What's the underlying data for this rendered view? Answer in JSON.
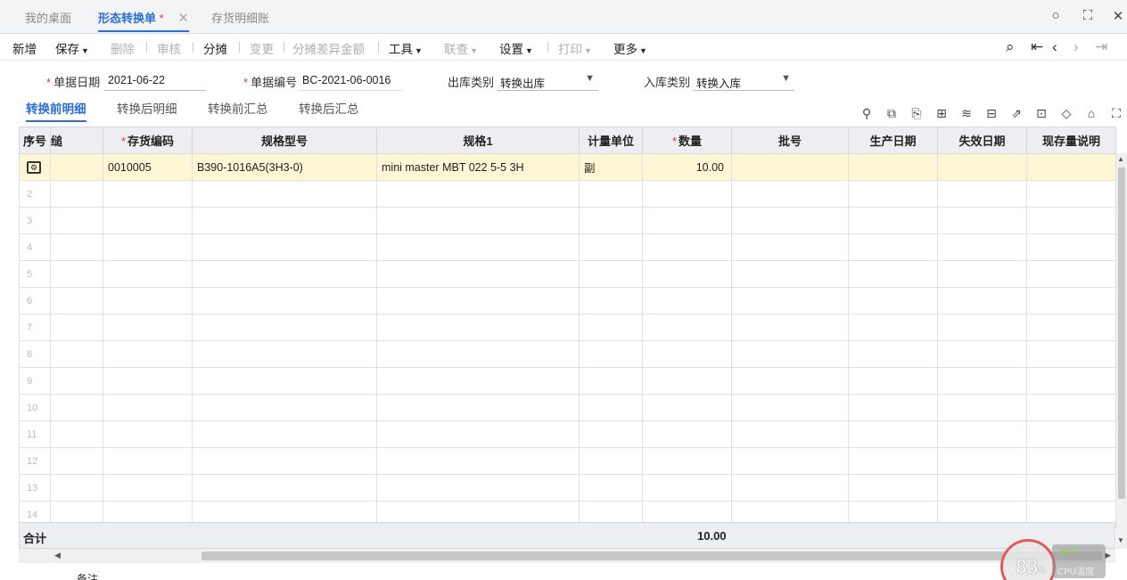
{
  "tabs": [
    {
      "label": "我的桌面"
    },
    {
      "label": "形态转换单",
      "dirty": "*"
    },
    {
      "label": "存货明细账"
    }
  ],
  "window_icons": {
    "search": "○",
    "expand": "⛶",
    "close": "✕"
  },
  "toolbar": {
    "new": "新增",
    "save": "保存",
    "delete": "删除",
    "audit": "审核",
    "allocate": "分摊",
    "change": "变更",
    "allocate_diff": "分摊差异金额",
    "tools": "工具",
    "query": "联查",
    "settings": "设置",
    "print": "打印",
    "more": "更多"
  },
  "form": {
    "date_label": "单据日期",
    "date_value": "2021-06-22",
    "code_label": "单据编号",
    "code_value": "BC-2021-06-0016",
    "out_type_label": "出库类别",
    "out_type_value": "转换出库",
    "in_type_label": "入库类别",
    "in_type_value": "转换入库"
  },
  "subtabs": [
    "转换前明细",
    "转换后明细",
    "转换前汇总",
    "转换后汇总"
  ],
  "grid": {
    "headers": [
      "序号",
      "",
      "存货编码",
      "规格型号",
      "规格1",
      "计量单位",
      "数量",
      "批号",
      "生产日期",
      "失效日期",
      "现存量说明"
    ],
    "header_col1_fragment": "缒",
    "rows": [
      {
        "no": "",
        "code": "0010005",
        "spec": "B390-1016A5(3H3-0)",
        "spec1": "mini master MBT 022 5-5 3H",
        "unit": "副",
        "qty": "10.00"
      },
      {
        "no": "2"
      },
      {
        "no": "3"
      },
      {
        "no": "4"
      },
      {
        "no": "5"
      },
      {
        "no": "6"
      },
      {
        "no": "7"
      },
      {
        "no": "8"
      },
      {
        "no": "9"
      },
      {
        "no": "10"
      },
      {
        "no": "11"
      },
      {
        "no": "12"
      },
      {
        "no": "13"
      },
      {
        "no": "14"
      }
    ],
    "total_label": "合计",
    "total_qty": "10.00"
  },
  "note_label": "备注",
  "cpu": {
    "percent": "83",
    "unit": "%",
    "temp": "28℃",
    "label": "CPU温度"
  }
}
